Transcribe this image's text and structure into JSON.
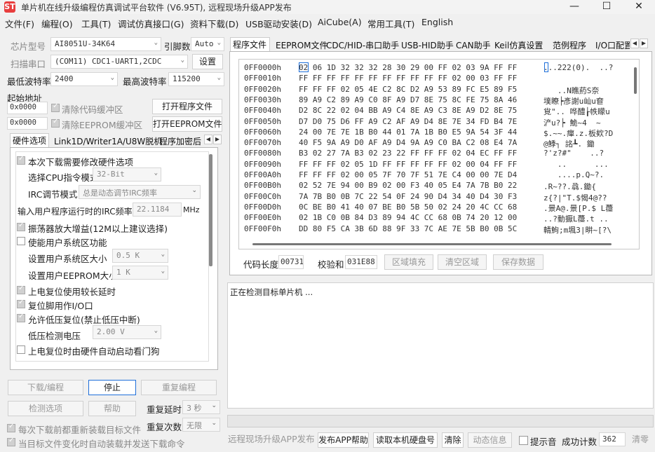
{
  "window": {
    "title": "单片机在线升级编程仿真调试平台软件 (V6.95T), 远程现场升级APP发布",
    "logo_glyph": "ST"
  },
  "menu": [
    "文件(F)",
    "编程(O)",
    "工具(T)",
    "调试仿真接口(G)",
    "资料下载(D)",
    "USB驱动安装(D)",
    "AiCube(A)",
    "常用工具(T)",
    "English"
  ],
  "left": {
    "chip_label": "芯片型号",
    "chip_value": "AI8051U-34K64",
    "pins_label": "引脚数",
    "pins_value": "Auto",
    "port_button": "扫描串口",
    "port_value": "(COM11) CDC1-UART1,2CDC",
    "settings_button": "设置",
    "min_baud_label": "最低波特率",
    "min_baud_value": "2400",
    "max_baud_label": "最高波特率",
    "max_baud_value": "115200",
    "start_addr_label": "起始地址",
    "code_addr": "0x0000",
    "clear_code_label": "清除代码缓冲区",
    "open_prog_button": "打开程序文件",
    "eeprom_addr": "0x0000",
    "clear_eeprom_label": "清除EEPROM缓冲区",
    "open_eeprom_button": "打开EEPROM文件",
    "tabs": [
      "硬件选项",
      "Link1D/Writer1A/U8W脱机",
      "程序加密后"
    ],
    "options": {
      "opt1": "本次下载需要修改硬件选项",
      "cpu_mode_label": "选择CPU指令模式",
      "cpu_mode_value": "32-Bit",
      "irc_label": "IRC调节模式",
      "irc_value": "总是动态调节IRC频率",
      "freq_label": "输入用户程序运行时的IRC频率",
      "freq_value": "22.1184",
      "freq_unit": "MHz",
      "osc": "振荡器放大增益(12M以上建议选择)",
      "sysreg": "使能用户系统区功能",
      "sys_size_label": "设置用户系统区大小",
      "sys_size_value": "0.5 K",
      "eeprom_size_label": "设置用户EEPROM大小",
      "eeprom_size_value": "1   K",
      "delay": "上电复位使用较长延时",
      "reset_pin": "复位脚用作I/O口",
      "lvr": "允许低压复位(禁止低压中断)",
      "lvd_label": "低压检测电压",
      "lvd_value": "2.00 V",
      "wdt": "上电复位时由硬件自动启动看门狗"
    },
    "btn_download": "下载/编程",
    "btn_stop": "停止",
    "btn_reprogram": "重复编程",
    "btn_detect": "检测选项",
    "btn_help": "帮助",
    "repeat_delay_label": "重复延时",
    "repeat_delay_value": "3 秒",
    "repeat_count_label": "重复次数",
    "repeat_count_value": "无限",
    "reload_label": "每次下载前都重新装载目标文件",
    "auto_send_label": "当目标文件变化时自动装载并发送下载命令"
  },
  "right": {
    "tabs": [
      "程序文件",
      "EEPROM文件",
      "CDC/HID-串口助手",
      "USB-HID助手",
      "CAN助手",
      "Keil仿真设置",
      "范例程序",
      "I/O口配置"
    ],
    "hex_rows": [
      {
        "addr": "0FF0000h",
        "bytes": "02 06 1D 32 32 32 28 30 29 00 FF 02 03 9A FF FF",
        "ascii": "...222(0).  ..?"
      },
      {
        "addr": "0FF0010h",
        "bytes": "FF FF FF FF FF FF FF FF FF FF FF 02 00 03 FF FF",
        "ascii": ""
      },
      {
        "addr": "0FF0020h",
        "bytes": "FF FF FF 02 05 4E C2 8C D2 A9 53 89 FC E5 89 F5",
        "ascii": "   ..N瞧葯S奈"
      },
      {
        "addr": "0FF0030h",
        "bytes": "89 A9 C2 89 A9 C0 8F A9 D7 8E 75 8C FE 75 8A 46",
        "ascii": "墣瞭┝彥謝u屾u奆"
      },
      {
        "addr": "0FF0040h",
        "bytes": "D2 8C 22 02 04 BB A9 C4 8E A9 C3 8E A9 D2 8E 75",
        "ascii": "覍\".. 哗醴┟帙矇u"
      },
      {
        "addr": "0FF0050h",
        "bytes": "D7 D0 75 D6 FF A9 C2 AF A9 D4 8E 7E 34 FD B4 7E",
        "ascii": "浐u?┝ 鮠~4  ~"
      },
      {
        "addr": "0FF0060h",
        "bytes": "24 00 7E 7E 1B B0 44 01 7A 1B B0 E5 9A 54 3F 44",
        "ascii": "$.~~.癉.z.板欸?D"
      },
      {
        "addr": "0FF0070h",
        "bytes": "40 F5 9A A9 D0 AF A9 D4 9A A9 C0 BA C2 08 E4 7A",
        "ascii": "@鯚┐ 詺┺. 鋤"
      },
      {
        "addr": "0FF0080h",
        "bytes": "B3 02 27 7A B3 02 23 22 FF FF FF 02 04 EC FF FF",
        "ascii": "?'z?#\"    ..?"
      },
      {
        "addr": "0FF0090h",
        "bytes": "FF FF FF 02 05 1D FF FF FF FF FF 02 00 04 FF FF",
        "ascii": "   ..      ..."
      },
      {
        "addr": "0FF00A0h",
        "bytes": "FF FF FF 02 00 05 7F 70 7F 51 7E C4 00 00 7E D4",
        "ascii": "   ....p.Q~?."
      },
      {
        "addr": "0FF00B0h",
        "bytes": "02 52 7E 94 00 B9 02 00 F3 40 05 E4 7A 7B B0 22",
        "ascii": ".R~??.骉.鋤{"
      },
      {
        "addr": "0FF00C0h",
        "bytes": "7A 7B B0 0B 7C 22 54 0F 24 90 D4 34 40 D4 30 F3",
        "ascii": "z{?|\"T.$愒4@??"
      },
      {
        "addr": "0FF00D0h",
        "bytes": "0C BE B0 41 40 07 BE B0 5B 50 02 24 20 4C CC 68",
        "ascii": ".景A@.景[P.$ L蘉"
      },
      {
        "addr": "0FF00E0h",
        "bytes": "02 1B C0 0B 84 D3 89 94 4C CC 68 0B 74 20 12 00",
        "ascii": "..?動擫L蘉.t .."
      },
      {
        "addr": "0FF00F0h",
        "bytes": "DD 80 F5 CA 3B 6D 88 9F 33 7C AE 7E 5B B0 0B 5C",
        "ascii": "輤鮈;m堸3|畊~[?\\"
      }
    ],
    "code_len_label": "代码长度",
    "code_len_value": "00731",
    "checksum_label": "校验和",
    "checksum_value": "031E88",
    "fill_button": "区域填充",
    "clear_button": "清空区域",
    "save_button": "保存数据",
    "log_text": "正在检测目标单片机 ..."
  },
  "status": {
    "publish_button": "远程现场升级APP发布",
    "publish_help_button": "发布APP帮助",
    "read_disk_button": "读取本机硬盘号",
    "clear_button": "清除",
    "anim_button": "动态信息",
    "beep_label": "提示音",
    "success_label": "成功计数",
    "success_value": "362",
    "clear_count_button": "清零"
  }
}
